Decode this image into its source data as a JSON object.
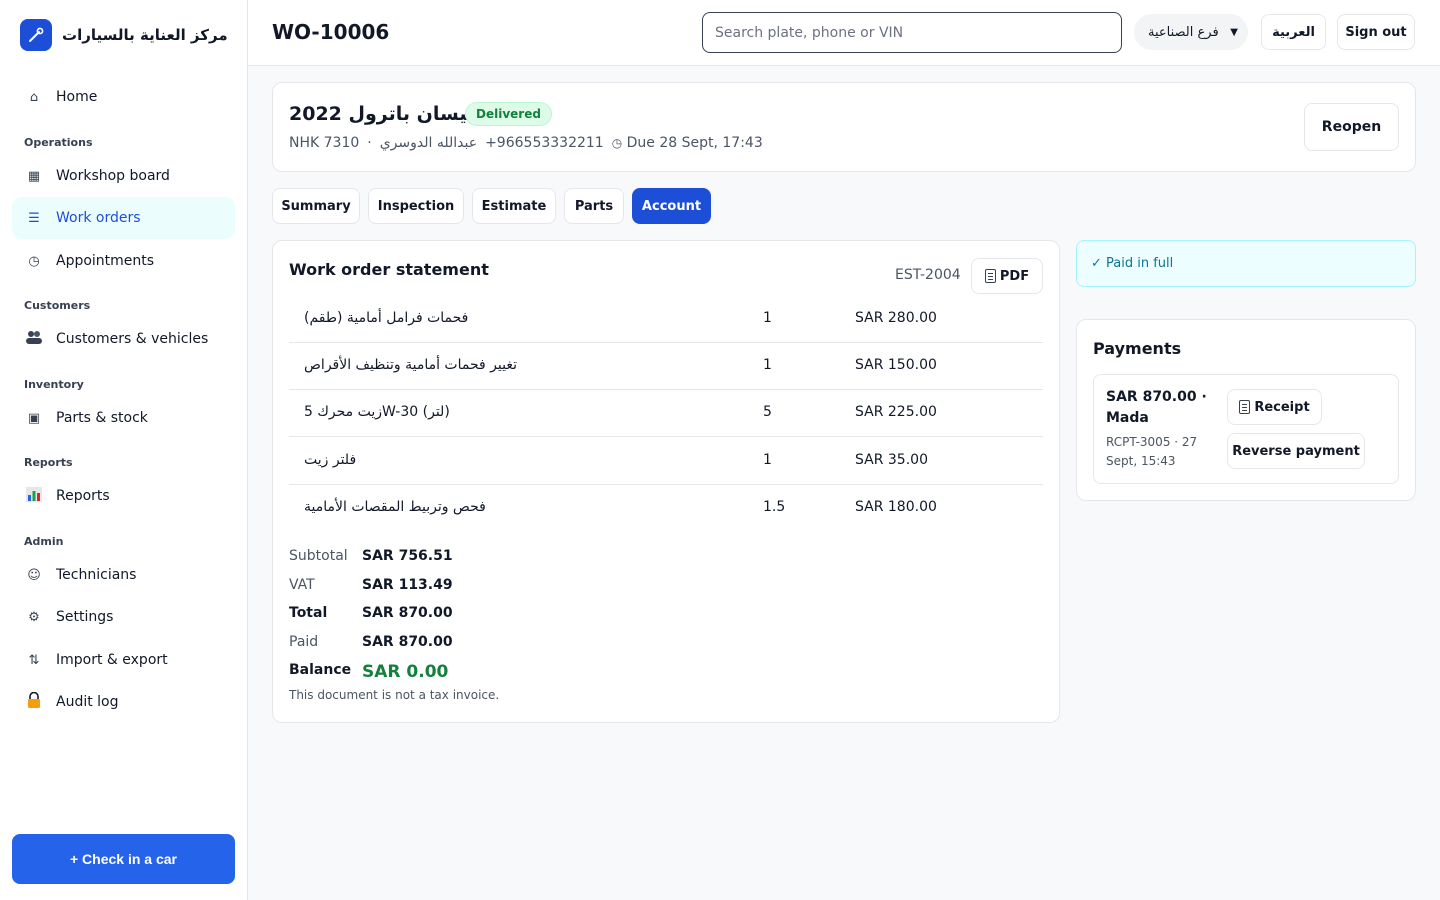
{
  "brand": {
    "name": "مركز العناية بالسيارات"
  },
  "sidebar": {
    "items": [
      {
        "label": "Home",
        "icon": "home-icon"
      },
      {
        "label": "Workshop board",
        "icon": "board-icon"
      },
      {
        "label": "Work orders",
        "icon": "list-icon"
      },
      {
        "label": "Appointments",
        "icon": "clock-icon"
      },
      {
        "label": "Customers & vehicles",
        "icon": "people-icon"
      },
      {
        "label": "Parts & stock",
        "icon": "box-icon"
      },
      {
        "label": "Reports",
        "icon": "chart-icon"
      },
      {
        "label": "Technicians",
        "icon": "smile-icon"
      },
      {
        "label": "Settings",
        "icon": "gear-icon"
      },
      {
        "label": "Import & export",
        "icon": "swap-icon"
      },
      {
        "label": "Audit log",
        "icon": "lock-icon"
      }
    ],
    "sections": [
      "Operations",
      "Customers",
      "Inventory",
      "Reports",
      "Admin"
    ],
    "checkin_label": "+ Check in a car"
  },
  "header": {
    "title": "WO-10006",
    "search_placeholder": "Search plate, phone or VIN",
    "branch": "فرع الصناعية",
    "language": "العربية",
    "signout": "Sign out"
  },
  "vehicle": {
    "title": "نيسان باترول 2022",
    "status": "Delivered",
    "plate": "NHK 7310",
    "separator": "·",
    "customer": "عبدالله الدوسري",
    "phone": "+966553332211",
    "due": "Due 28 Sept, 17:43",
    "reopen": "Reopen"
  },
  "tabs": [
    "Summary",
    "Inspection",
    "Estimate",
    "Parts",
    "Account"
  ],
  "active_tab": "Account",
  "statement": {
    "title": "Work order statement",
    "ref": "EST-2004",
    "pdf": "PDF",
    "lines": [
      {
        "desc": "فحمات فرامل أمامية (طقم)",
        "qty": "1",
        "amount": "SAR 280.00"
      },
      {
        "desc": "تغيير فحمات أمامية وتنظيف الأقراص",
        "qty": "1",
        "amount": "SAR 150.00"
      },
      {
        "desc": "زيت محرك 5W-30 (لتر)",
        "qty": "5",
        "amount": "SAR 225.00"
      },
      {
        "desc": "فلتر زيت",
        "qty": "1",
        "amount": "SAR 35.00"
      },
      {
        "desc": "فحص وتربيط المقصات الأمامية",
        "qty": "1.5",
        "amount": "SAR 180.00"
      }
    ],
    "totals": {
      "subtotal_label": "Subtotal",
      "subtotal": "SAR 756.51",
      "vat_label": "VAT",
      "vat": "SAR 113.49",
      "total_label": "Total",
      "total": "SAR 870.00",
      "paid_label": "Paid",
      "paid": "SAR 870.00",
      "balance_label": "Balance",
      "balance": "SAR 0.00"
    },
    "note": "This document is not a tax invoice."
  },
  "paid_banner": "✓ Paid in full",
  "payments": {
    "title": "Payments",
    "items": [
      {
        "amount": "SAR 870.00 · Mada",
        "ref": "RCPT-3005 · 27 Sept, 15:43",
        "receipt": "Receipt",
        "reverse": "Reverse payment"
      }
    ]
  },
  "colors": {
    "accent": "#1d4ed8",
    "success": "#15803d",
    "active_nav_bg": "#ecfdfd"
  }
}
